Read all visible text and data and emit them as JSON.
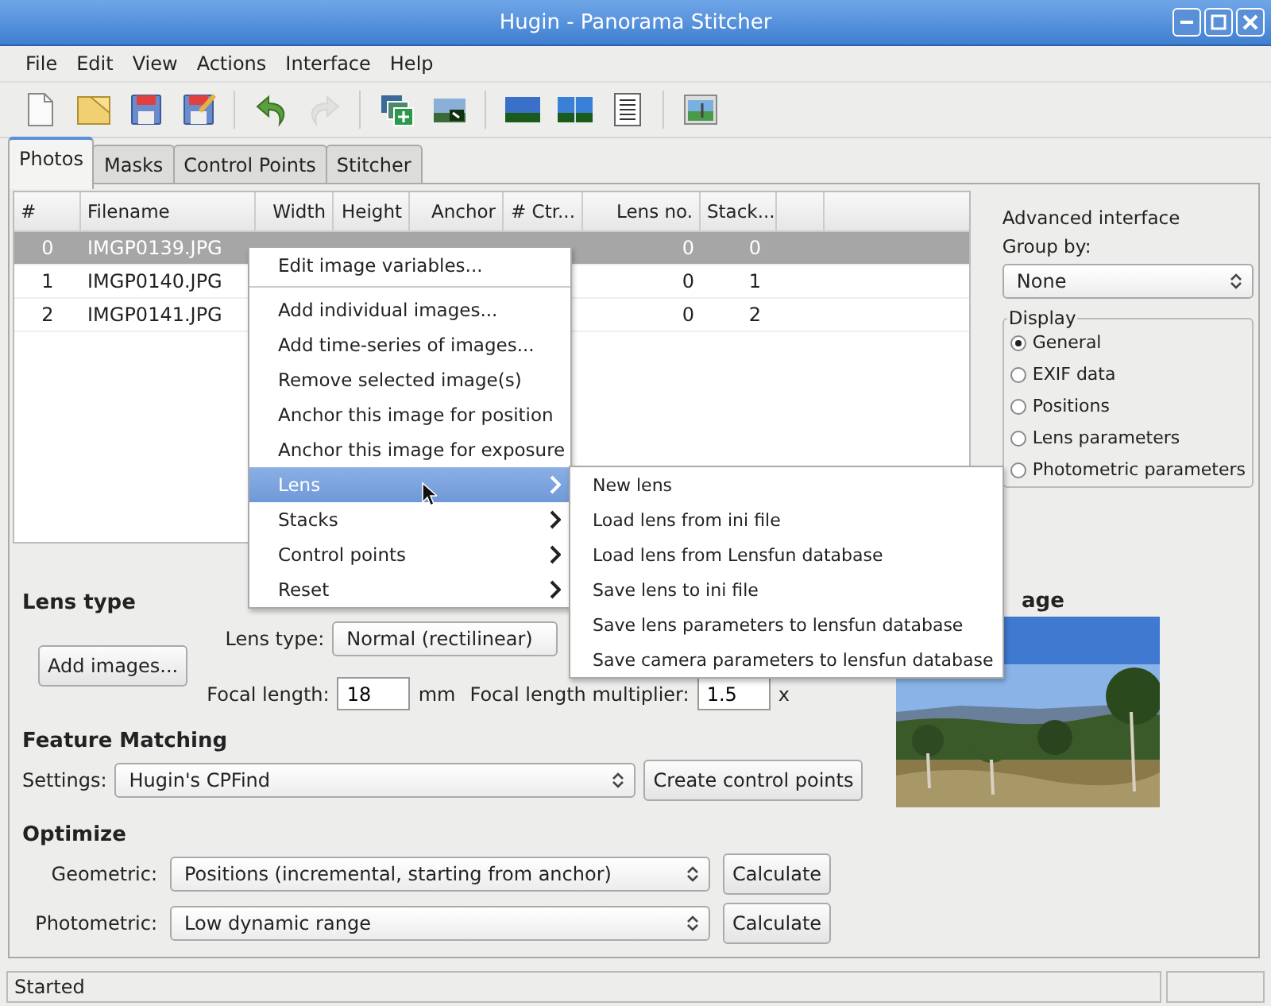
{
  "window": {
    "title": "Hugin - Panorama Stitcher"
  },
  "menu": [
    "File",
    "Edit",
    "View",
    "Actions",
    "Interface",
    "Help"
  ],
  "toolbar": [
    {
      "kind": "new",
      "disabled": false
    },
    {
      "kind": "open",
      "disabled": false
    },
    {
      "kind": "save",
      "disabled": false
    },
    {
      "kind": "save-as",
      "disabled": false
    },
    {
      "kind": "separator"
    },
    {
      "kind": "undo",
      "disabled": false
    },
    {
      "kind": "redo",
      "disabled": true
    },
    {
      "kind": "separator"
    },
    {
      "kind": "add-images",
      "disabled": false
    },
    {
      "kind": "add-series",
      "disabled": false
    },
    {
      "kind": "separator"
    },
    {
      "kind": "gl-preview",
      "disabled": false
    },
    {
      "kind": "fast-preview",
      "disabled": false
    },
    {
      "kind": "list",
      "disabled": false
    },
    {
      "kind": "separator"
    },
    {
      "kind": "panorama",
      "disabled": false
    }
  ],
  "tabs": [
    {
      "label": "Photos",
      "selected": true
    },
    {
      "label": "Masks",
      "selected": false
    },
    {
      "label": "Control Points",
      "selected": false
    },
    {
      "label": "Stitcher",
      "selected": false
    }
  ],
  "table": {
    "columns": [
      "#",
      "Filename",
      "Width",
      "Height",
      "Anchor",
      "# Ctr...",
      "Lens no.",
      "Stack..."
    ],
    "rows": [
      {
        "index": "0",
        "filename": "IMGP0139.JPG",
        "lens": "0",
        "stack": "0",
        "selected": true
      },
      {
        "index": "1",
        "filename": "IMGP0140.JPG",
        "lens": "0",
        "stack": "1",
        "selected": false
      },
      {
        "index": "2",
        "filename": "IMGP0141.JPG",
        "lens": "0",
        "stack": "2",
        "selected": false
      }
    ]
  },
  "sidebar": {
    "advanced_label": "Advanced interface",
    "group_by_label": "Group by:",
    "group_by_value": "None",
    "display": {
      "title": "Display",
      "options": [
        {
          "label": "General",
          "selected": true
        },
        {
          "label": "EXIF data",
          "selected": false
        },
        {
          "label": "Positions",
          "selected": false
        },
        {
          "label": "Lens parameters",
          "selected": false
        },
        {
          "label": "Photometric parameters",
          "selected": false
        }
      ]
    }
  },
  "lens_type": {
    "title": "Lens type",
    "add_images": "Add images...",
    "lens_type_label": "Lens type:",
    "lens_type_value": "Normal (rectilinear)",
    "focal_length_label": "Focal length:",
    "focal_length_value": "18",
    "focal_unit": "mm",
    "multiplier_label": "Focal length multiplier:",
    "multiplier_value": "1.5",
    "multiplier_unit": "x"
  },
  "preview": {
    "title": "age",
    "kind": "picture"
  },
  "feature_matching": {
    "title": "Feature Matching",
    "settings_label": "Settings:",
    "settings_value": "Hugin's CPFind",
    "button": "Create control points"
  },
  "optimize": {
    "title": "Optimize",
    "rows": [
      {
        "label": "Geometric:",
        "value": "Positions (incremental, starting from anchor)",
        "button": "Calculate"
      },
      {
        "label": "Photometric:",
        "value": "Low dynamic range",
        "button": "Calculate"
      }
    ]
  },
  "context_menu": {
    "items": [
      {
        "kind": "item",
        "label": "Edit image variables...",
        "selected": false
      },
      {
        "kind": "separator"
      },
      {
        "kind": "item",
        "label": "Add individual images...",
        "selected": false
      },
      {
        "kind": "item",
        "label": "Add time-series of images...",
        "selected": false
      },
      {
        "kind": "item",
        "label": "Remove selected image(s)",
        "selected": false
      },
      {
        "kind": "item",
        "label": "Anchor this image for position",
        "selected": false
      },
      {
        "kind": "item",
        "label": "Anchor this image for exposure",
        "selected": false
      },
      {
        "kind": "submenu",
        "label": "Lens",
        "selected": true
      },
      {
        "kind": "submenu",
        "label": "Stacks",
        "selected": false
      },
      {
        "kind": "submenu",
        "label": "Control points",
        "selected": false
      },
      {
        "kind": "submenu",
        "label": "Reset",
        "selected": false
      }
    ]
  },
  "submenu": {
    "items": [
      "New lens",
      "Load lens from ini file",
      "Load lens from Lensfun database",
      "Save lens to ini file",
      "Save lens parameters to lensfun database",
      "Save camera parameters to lensfun database"
    ]
  },
  "status_bar": {
    "text": "Started"
  }
}
